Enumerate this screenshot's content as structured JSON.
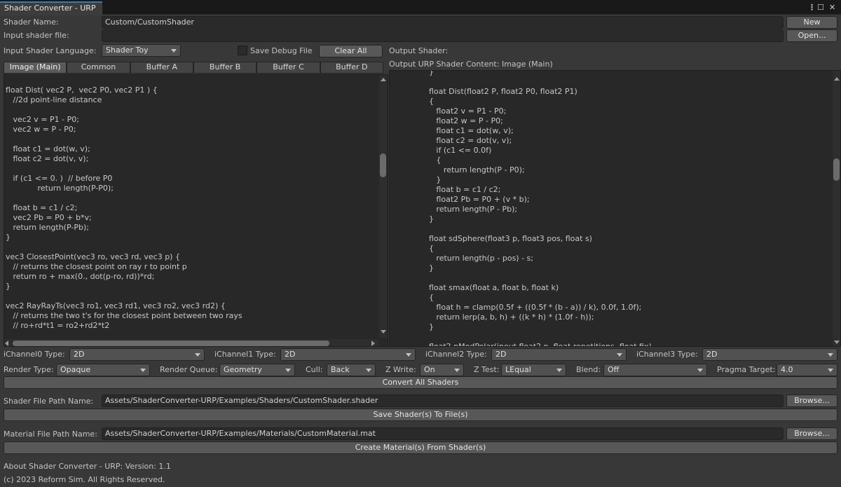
{
  "window": {
    "title": "Shader Converter - URP",
    "menu_icon": "⋮",
    "maximize_icon": "☐",
    "close_icon": "✕"
  },
  "shader_name": {
    "label": "Shader Name:",
    "value": "Custom/CustomShader"
  },
  "new_button": "New",
  "input_file": {
    "label": "Input shader file:",
    "value": ""
  },
  "open_button": "Open...",
  "input_language": {
    "label": "Input Shader Language:",
    "value": "Shader Toy"
  },
  "save_debug": {
    "label": "Save Debug File",
    "checked": false
  },
  "clear_all_button": "Clear All",
  "output_shader_label": "Output Shader:",
  "output_content_label": "Output URP Shader Content: Image (Main)",
  "tabs": [
    {
      "label": "Image (Main)",
      "active": true
    },
    {
      "label": "Common",
      "active": false
    },
    {
      "label": "Buffer A",
      "active": false
    },
    {
      "label": "Buffer B",
      "active": false
    },
    {
      "label": "Buffer C",
      "active": false
    },
    {
      "label": "Buffer D",
      "active": false
    }
  ],
  "input_code": "\nfloat Dist( vec2 P,  vec2 P0, vec2 P1 ) {\n   //2d point-line distance\n\n   vec2 v = P1 - P0;\n   vec2 w = P - P0;\n\n   float c1 = dot(w, v);\n   float c2 = dot(v, v);\n\n   if (c1 <= 0. )  // before P0\n             return length(P-P0);\n\n   float b = c1 / c2;\n   vec2 Pb = P0 + b*v;\n   return length(P-Pb);\n}\n\nvec3 ClosestPoint(vec3 ro, vec3 rd, vec3 p) {\n   // returns the closest point on ray r to point p\n   return ro + max(0., dot(p-ro, rd))*rd;\n}\n\nvec2 RayRayTs(vec3 ro1, vec3 rd1, vec3 ro2, vec3 rd2) {\n   // returns the two t's for the closest point between two rays\n   // ro+rd*t1 = ro2+rd2*t2",
  "output_code": "                }\n\n                float Dist(float2 P, float2 P0, float2 P1)\n                {\n                   float2 v = P1 - P0;\n                   float2 w = P - P0;\n                   float c1 = dot(w, v);\n                   float c2 = dot(v, v);\n                   if (c1 <= 0.0f)\n                   {\n                      return length(P - P0);\n                   }\n                   float b = c1 / c2;\n                   float2 Pb = P0 + (v * b);\n                   return length(P - Pb);\n                }\n\n                float sdSphere(float3 p, float3 pos, float s)\n                {\n                   return length(p - pos) - s;\n                }\n\n                float smax(float a, float b, float k)\n                {\n                   float h = clamp(0.5f + ((0.5f * (b - a)) / k), 0.0f, 1.0f);\n                   return lerp(a, b, h) + ((k * h) * (1.0f - h));\n                }\n\n                float2 pModPolar(inout float2 p, float repetitions, float fix)",
  "channels": [
    {
      "label": "iChannel0 Type:",
      "value": "2D"
    },
    {
      "label": "iChannel1 Type:",
      "value": "2D"
    },
    {
      "label": "iChannel2 Type:",
      "value": "2D"
    },
    {
      "label": "iChannel3 Type:",
      "value": "2D"
    }
  ],
  "render_settings": {
    "render_type": {
      "label": "Render Type:",
      "value": "Opaque"
    },
    "render_queue": {
      "label": "Render Queue:",
      "value": "Geometry"
    },
    "cull": {
      "label": "Cull:",
      "value": "Back"
    },
    "z_write": {
      "label": "Z Write:",
      "value": "On"
    },
    "z_test": {
      "label": "Z Test:",
      "value": "LEqual"
    },
    "blend": {
      "label": "Blend:",
      "value": "Off"
    },
    "pragma_target": {
      "label": "Pragma Target:",
      "value": "4.0"
    }
  },
  "convert_all_button": "Convert All Shaders",
  "shader_path": {
    "label": "Shader File Path Name:",
    "value": "Assets/ShaderConverter-URP/Examples/Shaders/CustomShader.shader"
  },
  "browse_label": "Browse...",
  "save_shaders_button": "Save Shader(s) To File(s)",
  "material_path": {
    "label": "Material File Path Name:",
    "value": "Assets/ShaderConverter-URP/Examples/Materials/CustomMaterial.mat"
  },
  "create_material_button": "Create Material(s) From Shader(s)",
  "about": "About Shader Converter - URP: Version: 1.1",
  "copyright": "(c) 2023 Reform Sim. All Rights Reserved.",
  "colors": {
    "background": "#383838",
    "editor": "#282828",
    "title_tab": "#3c3c3c"
  }
}
